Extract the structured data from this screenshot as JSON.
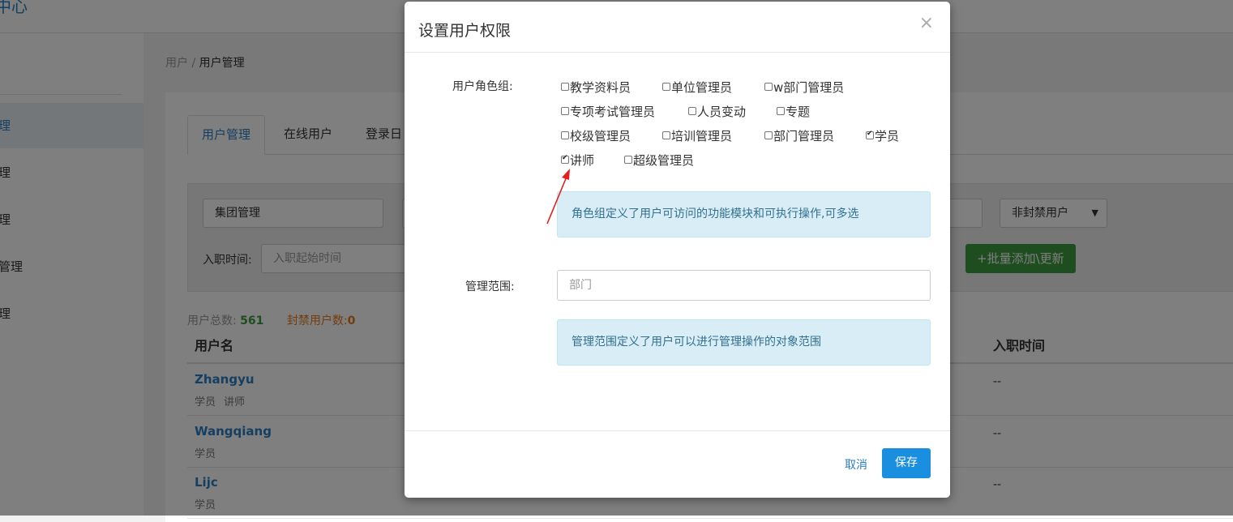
{
  "header": {
    "brand_fragment": "中心"
  },
  "sidebar": {
    "items": [
      {
        "label": "理",
        "active": true
      },
      {
        "label": "理",
        "active": false
      },
      {
        "label": "理",
        "active": false
      },
      {
        "label": "管理",
        "active": false
      },
      {
        "label": "理",
        "active": false
      }
    ]
  },
  "breadcrumb": {
    "root": "用户",
    "separator": " / ",
    "current": "用户管理"
  },
  "tabs": [
    {
      "label": "用户管理",
      "active": true
    },
    {
      "label": "在线用户",
      "active": false
    },
    {
      "label": "登录日",
      "active": false
    }
  ],
  "filters": {
    "group_value": "集团管理",
    "status_select": "非封禁用户",
    "hire_label": "入职时间:",
    "hire_placeholder": "入职起始时间",
    "batch_button": "+批量添加\\更新"
  },
  "stats": {
    "total_label": "用户总数:",
    "total_value": "561",
    "banned_label": "封禁用户数:",
    "banned_value": "0"
  },
  "table": {
    "headers": {
      "username": "用户名",
      "hire_time": "入职时间"
    },
    "rows": [
      {
        "name": "Zhangyu",
        "roles": [
          "学员",
          "讲师"
        ],
        "hire_time": "--"
      },
      {
        "name": "Wangqiang",
        "roles": [
          "学员"
        ],
        "hire_time": "--"
      },
      {
        "name": "Lijc",
        "roles": [
          "学员"
        ],
        "hire_time": "--"
      }
    ]
  },
  "modal": {
    "title": "设置用户权限",
    "close": "×",
    "role_label": "用户角色组:",
    "roles": [
      {
        "label": "教学资料员",
        "checked": false
      },
      {
        "label": "单位管理员",
        "checked": false
      },
      {
        "label": "w部门管理员",
        "checked": false
      },
      {
        "label": "专项考试管理员",
        "checked": false
      },
      {
        "label": "人员变动",
        "checked": false
      },
      {
        "label": "专题",
        "checked": false
      },
      {
        "label": "校级管理员",
        "checked": false
      },
      {
        "label": "培训管理员",
        "checked": false
      },
      {
        "label": "部门管理员",
        "checked": false
      },
      {
        "label": "学员",
        "checked": true
      },
      {
        "label": "讲师",
        "checked": true
      },
      {
        "label": "超级管理员",
        "checked": false
      }
    ],
    "role_info": "角色组定义了用户可访问的功能模块和可执行操作,可多选",
    "scope_label": "管理范围:",
    "scope_placeholder": "部门",
    "scope_info": "管理范围定义了用户可以进行管理操作的对象范围",
    "cancel": "取消",
    "save": "保存",
    "annotation_color": "#e02020"
  }
}
